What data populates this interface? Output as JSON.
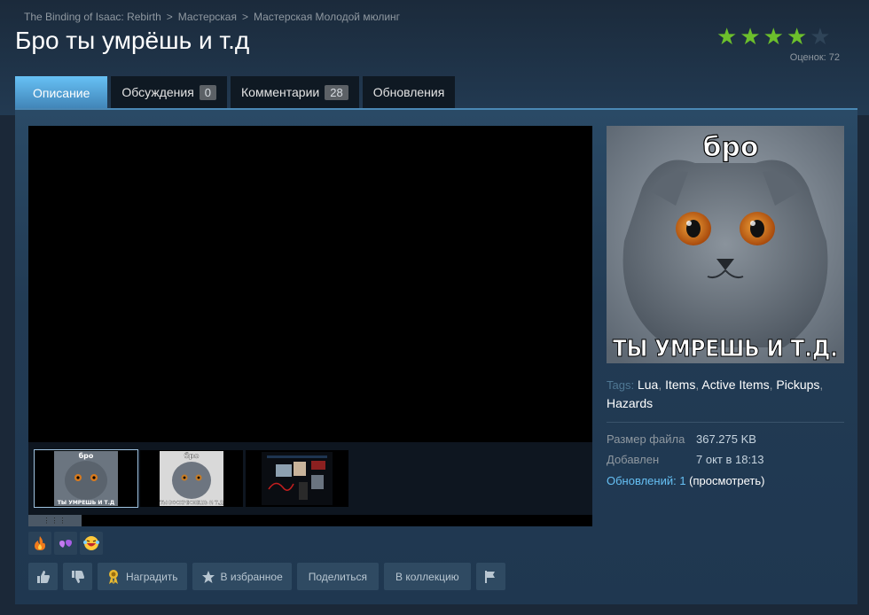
{
  "breadcrumb": {
    "game": "The Binding of Isaac: Rebirth",
    "sep1": ">",
    "workshop": "Мастерская",
    "sep2": ">",
    "author_workshop": "Мастерская Молодой мюлинг"
  },
  "item": {
    "title": "Бро ты умрёшь и т.д"
  },
  "rating": {
    "stars": 4,
    "max": 5,
    "text": "Оценок: 72",
    "star_color": "#6cbf2c"
  },
  "tabs": [
    {
      "label": "Описание",
      "count": null,
      "active": true
    },
    {
      "label": "Обсуждения",
      "count": "0",
      "active": false
    },
    {
      "label": "Комментарии",
      "count": "28",
      "active": false
    },
    {
      "label": "Обновления",
      "count": null,
      "active": false
    }
  ],
  "media": {
    "thumbs": [
      {
        "top_caption": "бро",
        "bottom_caption": "ТЫ УМРЕШЬ И Т.Д"
      },
      {
        "top_caption": "бро",
        "bottom_caption": "ТЫ ВОСКРЕСНЕШЬ И Т.Д"
      },
      {
        "top_caption": "",
        "bottom_caption": ""
      }
    ]
  },
  "preview": {
    "top_caption": "бро",
    "bottom_caption": "ТЫ УМРЕШЬ И Т.Д."
  },
  "tags": {
    "label": "Tags:",
    "items": [
      "Lua",
      "Items",
      "Active Items",
      "Pickups",
      "Hazards"
    ]
  },
  "details": {
    "size_label": "Размер файла",
    "size_value": "367.275 KB",
    "added_label": "Добавлен",
    "added_value": "7 окт в 18:13",
    "updates_link": "Обновлений: 1",
    "updates_view": "(просмотреть)"
  },
  "awards": [
    "fire-award-icon",
    "heart-award-icon",
    "laugh-award-icon"
  ],
  "actions": {
    "award": "Наградить",
    "favorite": "В избранное",
    "share": "Поделиться",
    "collection": "В коллекцию"
  },
  "colors": {
    "accent": "#67c1f5",
    "link": "#66c0f4",
    "background": "#1b2838"
  }
}
